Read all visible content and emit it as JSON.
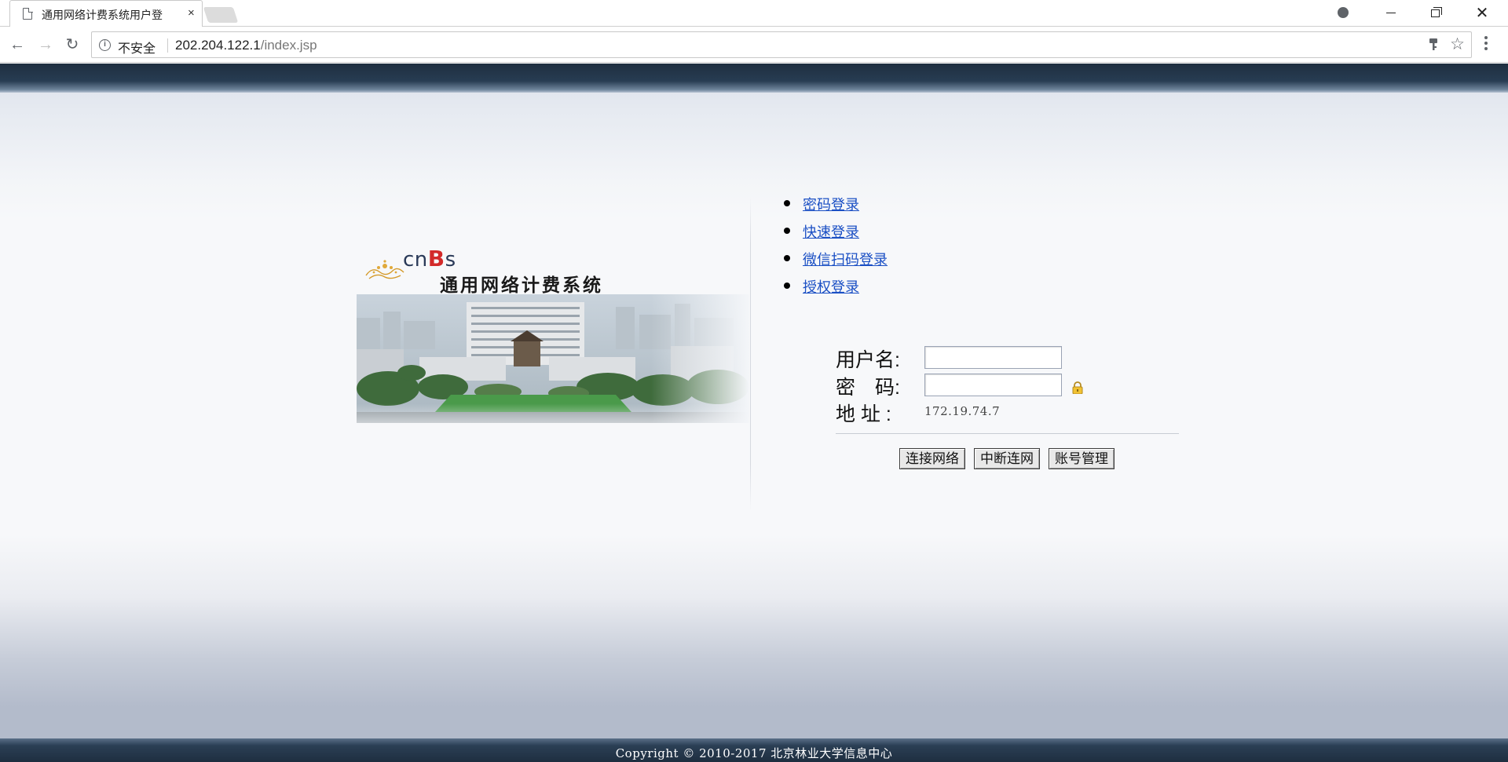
{
  "browser": {
    "tab_title": "通用网络计费系统用户登",
    "tab_close": "×",
    "security_label": "不安全",
    "url_host": "202.204.122.1",
    "url_path": "/index.jsp"
  },
  "header": {
    "logo_text_a": "cn",
    "logo_text_b": "B",
    "logo_text_c": "s",
    "system_title": "通用网络计费系统"
  },
  "login_options": [
    {
      "label": "密码登录"
    },
    {
      "label": "快速登录"
    },
    {
      "label": "微信扫码登录"
    },
    {
      "label": "授权登录"
    }
  ],
  "form": {
    "username_label": "用户名:",
    "password_label": "密　码:",
    "address_label": "地 址 :",
    "username_value": "",
    "password_value": "",
    "address_value": "172.19.74.7"
  },
  "buttons": {
    "connect": "连接网络",
    "disconnect": "中断连网",
    "account": "账号管理"
  },
  "footer": {
    "copyright": "Copyright © 2010-2017 北京林业大学信息中心"
  },
  "colors": {
    "header_band": "#1f2f40",
    "link": "#1a4fc4",
    "logo_red": "#d32a2a"
  }
}
